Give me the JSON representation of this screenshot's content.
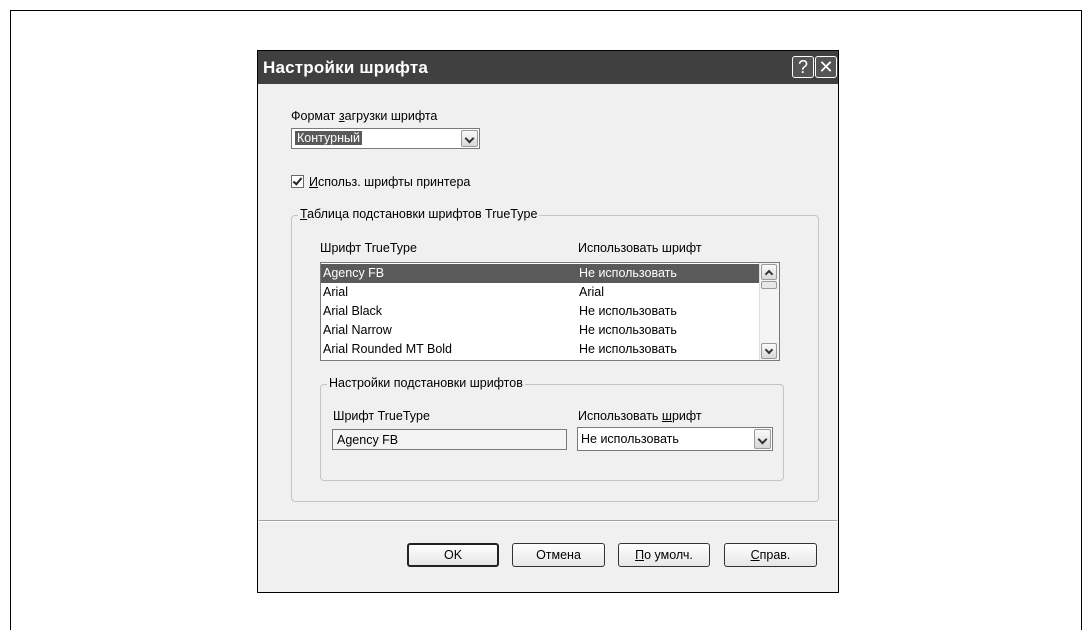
{
  "dialog": {
    "title": "Настройки шрифта",
    "help_glyph": "?",
    "close_glyph": "✕"
  },
  "download_format": {
    "label_pre": "Формат ",
    "label_mnemonic": "з",
    "label_post": "агрузки шрифта",
    "value": "Контурный"
  },
  "printer_fonts": {
    "checked": true,
    "label_mnemonic": "И",
    "label_post": "спольз. шрифты принтера"
  },
  "substitution_table": {
    "group_mnemonic": "Т",
    "group_post": "аблица подстановки шрифтов TrueType",
    "col_truetype": "Шрифт TrueType",
    "col_use": "Использовать шрифт",
    "rows": [
      {
        "font": "Agency FB",
        "use": "Не использовать",
        "selected": true
      },
      {
        "font": "Arial",
        "use": "Arial",
        "selected": false
      },
      {
        "font": "Arial Black",
        "use": "Не использовать",
        "selected": false
      },
      {
        "font": "Arial Narrow",
        "use": "Не использовать",
        "selected": false
      },
      {
        "font": "Arial Rounded MT Bold",
        "use": "Не использовать",
        "selected": false
      }
    ]
  },
  "substitution_settings": {
    "group_title": "Настройки подстановки шрифтов",
    "truetype_label": "Шрифт TrueType",
    "truetype_value": "Agency FB",
    "use_label_pre": "Использовать ",
    "use_label_mnemonic": "ш",
    "use_label_post": "рифт",
    "use_value": "Не использовать"
  },
  "buttons": {
    "ok": "OK",
    "cancel": "Отмена",
    "defaults_mnemonic": "П",
    "defaults_post": "о умолч.",
    "help_mnemonic": "С",
    "help_post": "прав."
  },
  "colors": {
    "titlebar": "#404040",
    "selection": "#5a5a5a",
    "dialog_bg": "#f0f0f0"
  }
}
